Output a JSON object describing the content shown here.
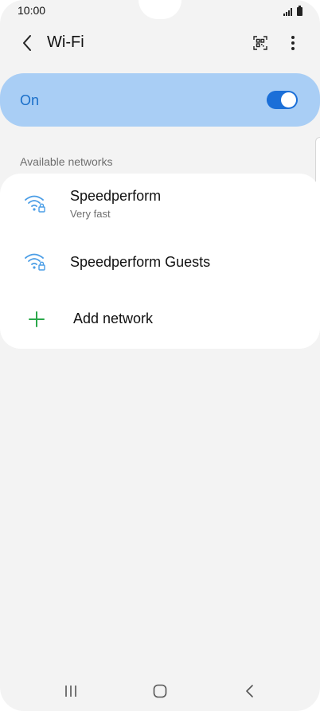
{
  "status_bar": {
    "time": "10:00"
  },
  "header": {
    "title": "Wi-Fi"
  },
  "master_switch": {
    "label": "On",
    "enabled": true
  },
  "section": {
    "label": "Available networks"
  },
  "networks": [
    {
      "name": "Speedperform",
      "subtitle": "Very fast",
      "icon": "wifi-lock-icon"
    },
    {
      "name": "Speedperform Guests",
      "subtitle": "",
      "icon": "wifi-lock-icon"
    }
  ],
  "add_network": {
    "label": "Add network",
    "icon": "plus-icon"
  },
  "colors": {
    "accent": "#1b6fd8",
    "card_highlight": "#a9cef5",
    "wifi_icon": "#4a9de6",
    "add_icon": "#2aa84a"
  }
}
